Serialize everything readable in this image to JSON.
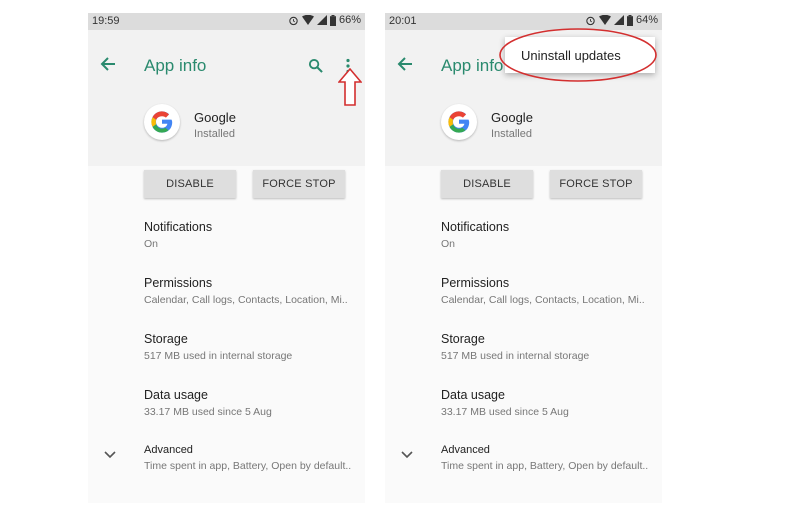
{
  "left_phone": {
    "status_time": "19:59",
    "battery": "66%",
    "header_title": "App info",
    "app_name": "Google",
    "app_status": "Installed",
    "buttons": {
      "disable": "DISABLE",
      "force_stop": "FORCE STOP"
    },
    "items": [
      {
        "title": "Notifications",
        "subtitle": "On"
      },
      {
        "title": "Permissions",
        "subtitle": "Calendar, Call logs, Contacts, Location, Mi.."
      },
      {
        "title": "Storage",
        "subtitle": "517 MB used in internal storage"
      },
      {
        "title": "Data usage",
        "subtitle": "33.17 MB used since 5 Aug"
      },
      {
        "title": "Advanced",
        "subtitle": "Time spent in app, Battery, Open by default.."
      }
    ]
  },
  "right_phone": {
    "status_time": "20:01",
    "battery": "64%",
    "header_title": "App info",
    "menu_item": "Uninstall updates",
    "app_name": "Google",
    "app_status": "Installed",
    "buttons": {
      "disable": "DISABLE",
      "force_stop": "FORCE STOP"
    },
    "items": [
      {
        "title": "Notifications",
        "subtitle": "On"
      },
      {
        "title": "Permissions",
        "subtitle": "Calendar, Call logs, Contacts, Location, Mi.."
      },
      {
        "title": "Storage",
        "subtitle": "517 MB used in internal storage"
      },
      {
        "title": "Data usage",
        "subtitle": "33.17 MB used since 5 Aug"
      },
      {
        "title": "Advanced",
        "subtitle": "Time spent in app, Battery, Open by default.."
      }
    ]
  },
  "colors": {
    "accent": "#2a8a6e",
    "annotation": "#d32f2f"
  },
  "icons": [
    "back-arrow-icon",
    "search-icon",
    "more-vert-icon",
    "google-g-icon",
    "chevron-down-icon",
    "alarm-icon",
    "wifi-icon",
    "signal-icon",
    "battery-icon"
  ]
}
